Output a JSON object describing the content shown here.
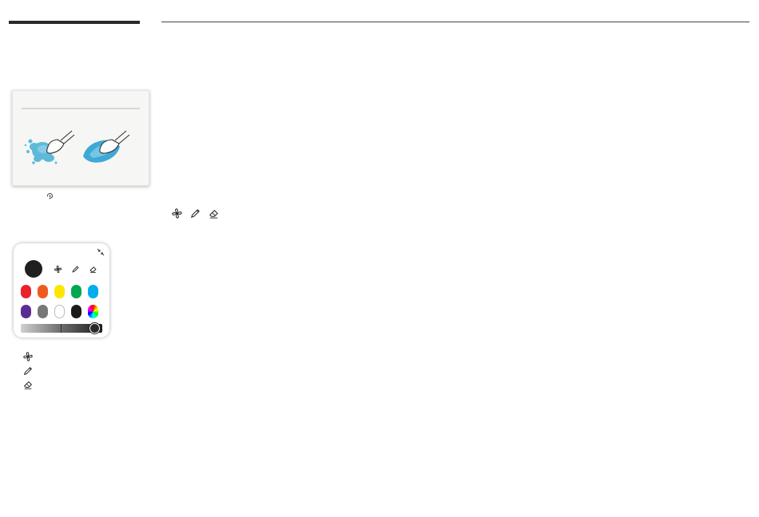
{
  "palette": {
    "current_color": "#1f1f1f",
    "tool_icons": [
      "pinwheel-icon",
      "pen-icon",
      "eraser-icon"
    ],
    "swatches_row1": [
      "#e8232a",
      "#f05a1e",
      "#ffe500",
      "#00a651",
      "#00aeef"
    ],
    "swatches_row2": [
      "#5b2c91",
      "#777777",
      "#ffffff",
      "#1a1a1a",
      "rainbow"
    ],
    "brightness_level": 0.95
  },
  "legend_icons": [
    "pinwheel-icon",
    "pen-icon",
    "eraser-icon"
  ],
  "inline_tool_icons": [
    "pinwheel-icon",
    "pen-icon",
    "eraser-icon"
  ]
}
